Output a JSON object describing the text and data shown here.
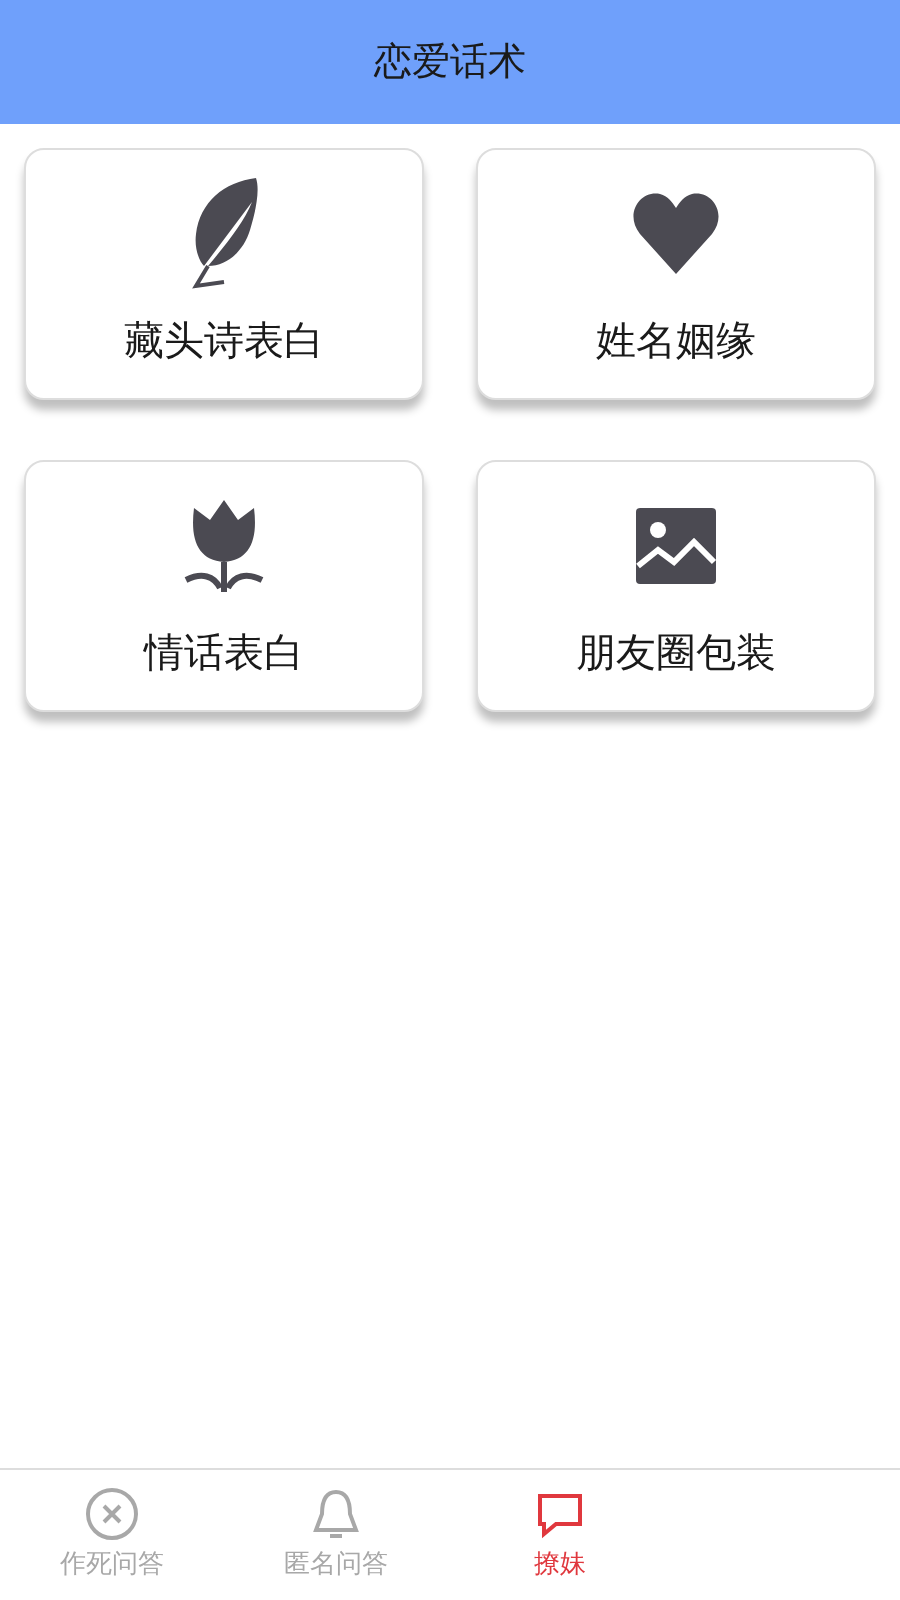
{
  "header": {
    "title": "恋爱话术"
  },
  "cards": [
    {
      "kind": "feather",
      "label": "藏头诗表白"
    },
    {
      "kind": "heart",
      "label": "姓名姻缘"
    },
    {
      "kind": "tulip",
      "label": "情话表白"
    },
    {
      "kind": "image",
      "label": "朋友圈包装"
    }
  ],
  "tab_bar": [
    {
      "kind": "close",
      "label": "作死问答",
      "selected": false
    },
    {
      "kind": "bell",
      "label": "匿名问答",
      "selected": false
    },
    {
      "kind": "chat",
      "label": "撩妹",
      "selected": true
    }
  ]
}
